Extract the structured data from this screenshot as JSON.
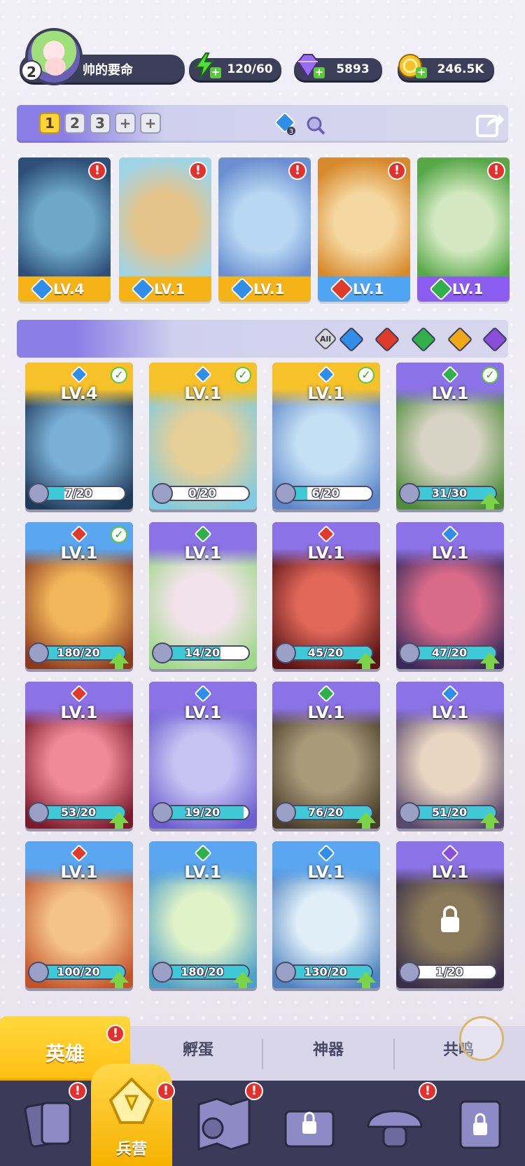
{
  "player": {
    "level": "2",
    "name": "帅的要命"
  },
  "resources": {
    "energy": "120/60",
    "gems": "5893",
    "coins": "246.5K"
  },
  "team_tabs": [
    {
      "label": "1",
      "active": true
    },
    {
      "label": "2",
      "active": false
    },
    {
      "label": "3",
      "active": false
    },
    {
      "label": "+",
      "active": false
    },
    {
      "label": "+",
      "active": false
    }
  ],
  "team_gem_count": "3",
  "squad": [
    {
      "level": "LV.4",
      "element": "water",
      "bar_color": "#f5b318",
      "art": [
        "#6ea7c8",
        "#2d4f78"
      ]
    },
    {
      "level": "LV.1",
      "element": "water",
      "bar_color": "#f5b318",
      "art": [
        "#e4c48a",
        "#9fd4e6"
      ]
    },
    {
      "level": "LV.1",
      "element": "water",
      "bar_color": "#f5b318",
      "art": [
        "#b7d7f2",
        "#6b8fd1"
      ]
    },
    {
      "level": "LV.1",
      "element": "fire",
      "bar_color": "#4fa5f2",
      "art": [
        "#f5d7a0",
        "#d78a2d"
      ]
    },
    {
      "level": "LV.1",
      "element": "nature",
      "bar_color": "#8b5cf0",
      "art": [
        "#d3e8c0",
        "#58a84a"
      ]
    }
  ],
  "filter": {
    "all_label": "All",
    "elements": [
      "water",
      "fire",
      "nature",
      "light",
      "dark"
    ]
  },
  "elements_colors": {
    "water": "#2f8ee8",
    "fire": "#e03a2a",
    "nature": "#2fb04a",
    "light": "#f0a818",
    "dark": "#8a4fd8"
  },
  "heroes": [
    {
      "level": "LV.4",
      "element": "water",
      "progress": "7/20",
      "fraction": 0.35,
      "checked": true,
      "upgrade": false,
      "frame": "gold",
      "art": [
        "#7bb0d6",
        "#1f3b5a"
      ]
    },
    {
      "level": "LV.1",
      "element": "water",
      "progress": "0/20",
      "fraction": 0.0,
      "checked": true,
      "upgrade": false,
      "frame": "gold",
      "art": [
        "#e6cf96",
        "#7fcbe0"
      ]
    },
    {
      "level": "LV.1",
      "element": "water",
      "progress": "6/20",
      "fraction": 0.3,
      "checked": true,
      "upgrade": false,
      "frame": "gold",
      "art": [
        "#c4e0f5",
        "#5d86c9"
      ]
    },
    {
      "level": "LV.1",
      "element": "nature",
      "progress": "31/30",
      "fraction": 1.0,
      "checked": true,
      "upgrade": true,
      "frame": "purple",
      "art": [
        "#d8d3c4",
        "#4f8d3b"
      ]
    },
    {
      "level": "LV.1",
      "element": "fire",
      "progress": "180/20",
      "fraction": 1.0,
      "checked": true,
      "upgrade": true,
      "frame": "blue",
      "art": [
        "#f2b55a",
        "#8a3a1f"
      ]
    },
    {
      "level": "LV.1",
      "element": "nature",
      "progress": "14/20",
      "fraction": 0.7,
      "checked": false,
      "upgrade": false,
      "frame": "purple",
      "art": [
        "#f2e2ea",
        "#9fd98a"
      ]
    },
    {
      "level": "LV.1",
      "element": "fire",
      "progress": "45/20",
      "fraction": 1.0,
      "checked": false,
      "upgrade": true,
      "frame": "purple",
      "art": [
        "#e0675a",
        "#5a1414"
      ]
    },
    {
      "level": "LV.1",
      "element": "water",
      "progress": "47/20",
      "fraction": 1.0,
      "checked": false,
      "upgrade": true,
      "frame": "purple",
      "art": [
        "#d86b8a",
        "#3a2a5a"
      ]
    },
    {
      "level": "LV.1",
      "element": "fire",
      "progress": "53/20",
      "fraction": 1.0,
      "checked": false,
      "upgrade": true,
      "frame": "purple",
      "art": [
        "#f08a9a",
        "#7a1a2a"
      ]
    },
    {
      "level": "LV.1",
      "element": "water",
      "progress": "19/20",
      "fraction": 0.95,
      "checked": false,
      "upgrade": false,
      "frame": "purple",
      "art": [
        "#c6c2f2",
        "#6d5fd1"
      ]
    },
    {
      "level": "LV.1",
      "element": "nature",
      "progress": "76/20",
      "fraction": 1.0,
      "checked": false,
      "upgrade": true,
      "frame": "purple",
      "art": [
        "#a99a7a",
        "#4a3f2a"
      ]
    },
    {
      "level": "LV.1",
      "element": "water",
      "progress": "51/20",
      "fraction": 1.0,
      "checked": false,
      "upgrade": true,
      "frame": "purple",
      "art": [
        "#e8d5c2",
        "#5a4a6e"
      ]
    },
    {
      "level": "LV.1",
      "element": "fire",
      "progress": "100/20",
      "fraction": 1.0,
      "checked": false,
      "upgrade": true,
      "frame": "blue",
      "art": [
        "#f5c38a",
        "#c2542a"
      ]
    },
    {
      "level": "LV.1",
      "element": "nature",
      "progress": "180/20",
      "fraction": 1.0,
      "checked": false,
      "upgrade": true,
      "frame": "blue",
      "art": [
        "#dff2c8",
        "#4fa0c8"
      ]
    },
    {
      "level": "LV.1",
      "element": "water",
      "progress": "130/20",
      "fraction": 1.0,
      "checked": false,
      "upgrade": true,
      "frame": "blue",
      "art": [
        "#e0eef8",
        "#4f84c2"
      ]
    },
    {
      "level": "LV.1",
      "element": "dark",
      "progress": "1/20",
      "fraction": 0.05,
      "checked": false,
      "upgrade": false,
      "frame": "locked",
      "art": [
        "#8a7a5a",
        "#3a2f4a"
      ]
    }
  ],
  "sub_tabs": [
    {
      "label": "英雄",
      "active": true,
      "alert": true
    },
    {
      "label": "孵蛋",
      "active": false,
      "alert": false
    },
    {
      "label": "神器",
      "active": false,
      "alert": false
    },
    {
      "label": "共鸣",
      "active": false,
      "alert": false
    }
  ],
  "nav": [
    {
      "icon": "cards-icon",
      "label": "",
      "alert": true
    },
    {
      "icon": "barracks-icon",
      "label": "兵营",
      "alert": true,
      "active": true
    },
    {
      "icon": "map-icon",
      "label": "",
      "alert": true
    },
    {
      "icon": "locked-chest-icon",
      "label": "",
      "alert": false
    },
    {
      "icon": "mushroom-icon",
      "label": "",
      "alert": true
    },
    {
      "icon": "locked-door-icon",
      "label": "",
      "alert": false
    }
  ],
  "frame_colors": {
    "gold": "#f7c12a",
    "purple": "#8b72e6",
    "blue": "#5aa6f0",
    "locked": "#8b72e6"
  }
}
